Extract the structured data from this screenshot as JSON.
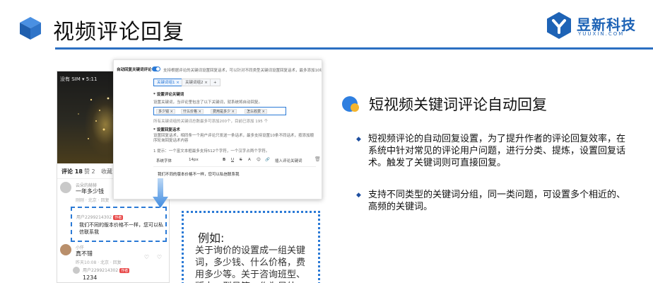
{
  "header": {
    "title": "视频评论回复",
    "brand_name": "昱新科技",
    "brand_sub": "YUUXIN.COM",
    "accent_color": "#2b6fc2"
  },
  "phone": {
    "status": "没有 SIM ▾ 5:11",
    "tabs": [
      {
        "label": "评论 18"
      },
      {
        "label": "赞 2"
      },
      {
        "label": "收藏"
      }
    ],
    "comments": [
      {
        "user": "云朵的赫赫",
        "text": "一年多少钱",
        "meta": "刚刚 · 北京 · 回复"
      },
      {
        "user": "小仟",
        "text": "真不错",
        "meta": "昨天10:08 · 北京 · 回复"
      },
      {
        "user": "用户2299214302",
        "badge": "作者",
        "text": "1234",
        "meta": ""
      }
    ],
    "reply": {
      "user": "用户2299214302",
      "badge": "作者",
      "text": "我们不同的版本价格不一样，您可以私信联系我"
    }
  },
  "settings": {
    "auto_reply_label": "自动回复关键词评论",
    "toggle_desc": "支持根据评论的关键词设置回复话术，可以针对不同类型关键词设置回复话术，最多添加10组",
    "group_tabs": [
      {
        "label": "关键词组1 ×",
        "active": true
      },
      {
        "label": "关键词组2 ×",
        "active": false
      },
      {
        "label": "+",
        "active": false
      }
    ],
    "keyword_label": "* 设置评论关键词",
    "keyword_hint": "设置关键词，当评论里包含了以下关键词，就系统将自动回复。",
    "keywords": [
      "多少钱 ×",
      "什么价格 ×",
      "费用是多少 ×",
      "怎么收费 ×"
    ],
    "keyword_count_hint": "所有关键词组的关键词总数最多可添加200个，目前已添加 195 个",
    "script_label": "* 设置回复话术",
    "script_hint": "设置回复话术，相同条一个用户评论只发送一条话术，最多支持设置10条不同话术，按添加顺序轮询回复话术内容",
    "script_tip": "1 提示：一个富文本框最多支持512个字符，一个汉字占两个字符。",
    "toolbar": {
      "font": "系统字体",
      "size": "14px",
      "bold": "B",
      "underline": "U",
      "strike": "S",
      "color": "A",
      "emoji": "☺",
      "link": "🔗",
      "insert": "插入评论关键词"
    },
    "editor_text": "我们不同的版本价格不一样，您可以私信联系我"
  },
  "example": {
    "title": "例如:",
    "text": "关于询价的设置成一组关键词，多少钱、什么价格，费用多少等。关于咨询班型、版本、型号等，作为另外一"
  },
  "panel": {
    "title": "短视频关键词评论自动回复",
    "bullets": [
      "短视频评论的自动回复设置，为了提升作者的评论回复效率，在系统中针对常见的评论用户问题，进行分类、提炼，设置回复话术。触发了关键词则可直接回复。",
      "支持不同类型的关键词分组，同一类问题，可设置多个相近的、高频的关键词。"
    ]
  }
}
